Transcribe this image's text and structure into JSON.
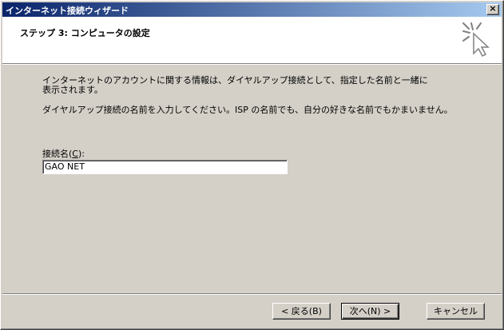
{
  "window": {
    "title": "インターネット接続ウィザード",
    "close_glyph": "×"
  },
  "header": {
    "title": "ステップ 3: コンピュータの設定",
    "icon": "wizard-cursor-icon"
  },
  "body": {
    "description": "インターネットのアカウントに関する情報は、ダイヤルアップ接続として、指定した名前と一緒に表示されます。",
    "instruction": "ダイヤルアップ接続の名前を入力してください。ISP の名前でも、自分の好きな名前でもかまいません。",
    "connection_name_label_prefix": "接続名(",
    "connection_name_label_key": "C",
    "connection_name_label_suffix": "):",
    "connection_name_value": "GAO NET"
  },
  "buttons": {
    "back": "< 戻る(B)",
    "next": "次へ(N) >",
    "cancel": "キャンセル"
  },
  "colors": {
    "titlebar_start": "#0a246a",
    "titlebar_end": "#a6caf0",
    "dialog_bg": "#d4d0c8"
  }
}
